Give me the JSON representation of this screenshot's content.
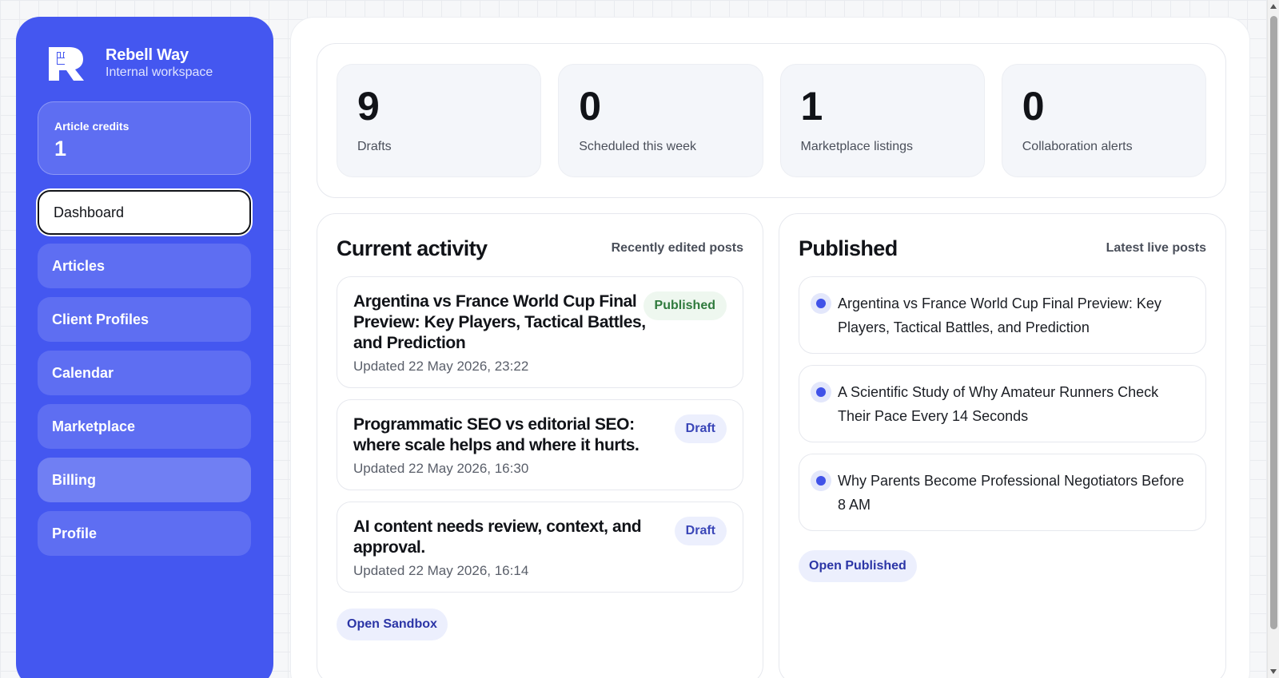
{
  "brand": {
    "name": "Rebell Way",
    "subtitle": "Internal workspace",
    "accent_color": "#4457f0"
  },
  "credits": {
    "label": "Article credits",
    "value": "1"
  },
  "nav": {
    "items": [
      {
        "label": "Dashboard",
        "active": true
      },
      {
        "label": "Articles"
      },
      {
        "label": "Client Profiles"
      },
      {
        "label": "Calendar"
      },
      {
        "label": "Marketplace"
      },
      {
        "label": "Billing"
      },
      {
        "label": "Profile"
      }
    ]
  },
  "stats": [
    {
      "value": "9",
      "label": "Drafts"
    },
    {
      "value": "0",
      "label": "Scheduled this week"
    },
    {
      "value": "1",
      "label": "Marketplace listings"
    },
    {
      "value": "0",
      "label": "Collaboration alerts"
    }
  ],
  "activity": {
    "title": "Current activity",
    "subtitle": "Recently edited posts",
    "items": [
      {
        "title": "Argentina vs France World Cup Final Preview: Key Players, Tactical Battles, and Prediction",
        "updated": "Updated 22 May 2026, 23:22",
        "status": "Published"
      },
      {
        "title": "Programmatic SEO vs editorial SEO: where scale helps and where it hurts.",
        "updated": "Updated 22 May 2026, 16:30",
        "status": "Draft"
      },
      {
        "title": "AI content needs review, context, and approval.",
        "updated": "Updated 22 May 2026, 16:14",
        "status": "Draft"
      }
    ],
    "button": "Open Sandbox"
  },
  "published": {
    "title": "Published",
    "subtitle": "Latest live posts",
    "items": [
      "Argentina vs France World Cup Final Preview: Key Players, Tactical Battles, and Prediction",
      "A Scientific Study of Why Amateur Runners Check Their Pace Every 14 Seconds",
      "Why Parents Become Professional Negotiators Before 8 AM"
    ],
    "button": "Open Published"
  }
}
